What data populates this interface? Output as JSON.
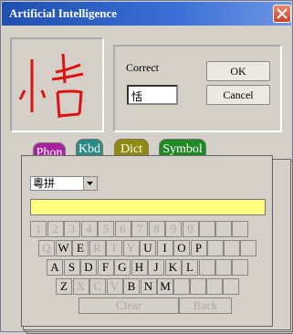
{
  "window": {
    "title": "Artificial Intelligence"
  },
  "correction": {
    "label": "Correct",
    "value": "恬"
  },
  "buttons": {
    "ok": "OK",
    "cancel": "Cancel"
  },
  "tabs": [
    {
      "label": "Phon",
      "color": "#a8249e"
    },
    {
      "label": "Kbd",
      "color": "#2b8a86"
    },
    {
      "label": "Dict",
      "color": "#8f8a10"
    },
    {
      "label": "Symbol",
      "color": "#1f8a24"
    }
  ],
  "keyboard": {
    "scheme": "粵拼",
    "digits": [
      "1",
      "2",
      "3",
      "4",
      "5",
      "6",
      "7",
      "8",
      "9",
      "0"
    ],
    "row1": [
      "Q",
      "W",
      "E",
      "R",
      "T",
      "Y",
      "U",
      "I",
      "O",
      "P"
    ],
    "row2": [
      "A",
      "S",
      "D",
      "F",
      "G",
      "H",
      "J",
      "K",
      "L"
    ],
    "row3": [
      "Z",
      "X",
      "C",
      "V",
      "B",
      "N",
      "M"
    ],
    "clear": "Clear",
    "back": "Back",
    "enabled": [
      "W",
      "E",
      "U",
      "I",
      "O",
      "P",
      "A",
      "S",
      "D",
      "F",
      "G",
      "H",
      "J",
      "K",
      "L",
      "Z",
      "B",
      "N",
      "M"
    ]
  },
  "colors": {
    "titlebar": "#1f4fb0",
    "ink": "#e01010",
    "highlight": "#ffff80"
  }
}
